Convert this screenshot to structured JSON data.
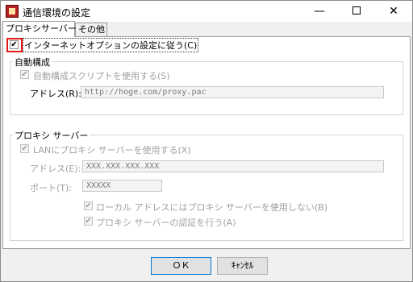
{
  "window": {
    "title": "通信環境の設定",
    "minimize_glyph": "—",
    "close_glyph": "✕"
  },
  "tabs": [
    {
      "label": "プロキシサーバー",
      "active": true
    },
    {
      "label": "その他",
      "active": false
    }
  ],
  "main": {
    "use_ie_options_label": "インターネットオプションの設定に従う(C)",
    "use_ie_options_checked": true
  },
  "auto_config": {
    "title": "自動構成",
    "use_script_label": "自動構成スクリプトを使用する(S)",
    "use_script_checked": true,
    "address_label": "アドレス(R):",
    "address_value": "http://hoge.com/proxy.pac"
  },
  "proxy_server": {
    "title": "プロキシ サーバー",
    "use_proxy_label": "LANにプロキシ サーバーを使用する(X)",
    "use_proxy_checked": true,
    "address_label": "アドレス(E):",
    "address_value": "XXX.XXX.XXX.XXX",
    "port_label": "ポート(T):",
    "port_value": "XXXXX",
    "bypass_local_label": "ローカル アドレスにはプロキシ サーバーを使用しない(B)",
    "bypass_local_checked": true,
    "auth_label": "プロキシ サーバーの認証を行う(A)",
    "auth_checked": true
  },
  "buttons": {
    "ok_label": "ＯＫ",
    "cancel_label": "ｷｬﾝｾﾙ"
  },
  "colors": {
    "highlight": "#e51b1b",
    "ok_border": "#0078d7"
  }
}
